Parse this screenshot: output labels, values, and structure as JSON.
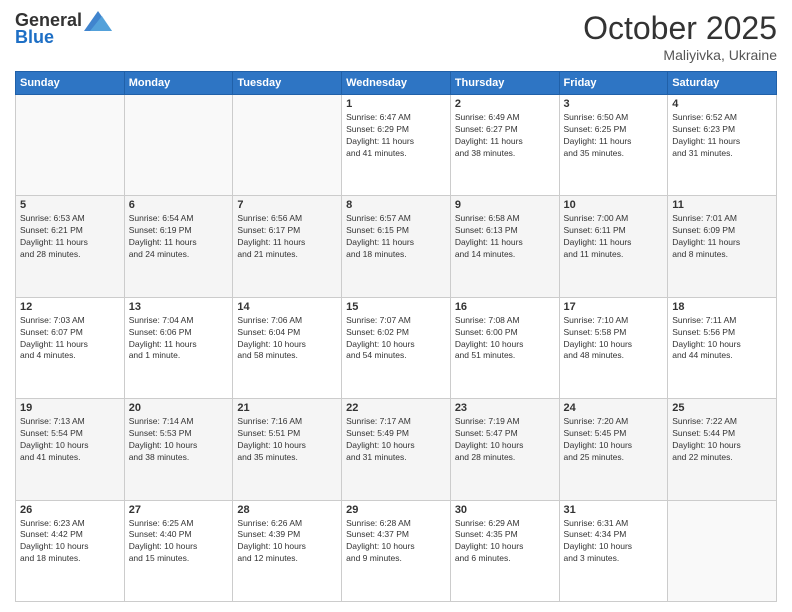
{
  "header": {
    "logo_general": "General",
    "logo_blue": "Blue",
    "month_title": "October 2025",
    "location": "Maliyivka, Ukraine"
  },
  "days_of_week": [
    "Sunday",
    "Monday",
    "Tuesday",
    "Wednesday",
    "Thursday",
    "Friday",
    "Saturday"
  ],
  "weeks": [
    [
      {
        "day": "",
        "info": ""
      },
      {
        "day": "",
        "info": ""
      },
      {
        "day": "",
        "info": ""
      },
      {
        "day": "1",
        "info": "Sunrise: 6:47 AM\nSunset: 6:29 PM\nDaylight: 11 hours\nand 41 minutes."
      },
      {
        "day": "2",
        "info": "Sunrise: 6:49 AM\nSunset: 6:27 PM\nDaylight: 11 hours\nand 38 minutes."
      },
      {
        "day": "3",
        "info": "Sunrise: 6:50 AM\nSunset: 6:25 PM\nDaylight: 11 hours\nand 35 minutes."
      },
      {
        "day": "4",
        "info": "Sunrise: 6:52 AM\nSunset: 6:23 PM\nDaylight: 11 hours\nand 31 minutes."
      }
    ],
    [
      {
        "day": "5",
        "info": "Sunrise: 6:53 AM\nSunset: 6:21 PM\nDaylight: 11 hours\nand 28 minutes."
      },
      {
        "day": "6",
        "info": "Sunrise: 6:54 AM\nSunset: 6:19 PM\nDaylight: 11 hours\nand 24 minutes."
      },
      {
        "day": "7",
        "info": "Sunrise: 6:56 AM\nSunset: 6:17 PM\nDaylight: 11 hours\nand 21 minutes."
      },
      {
        "day": "8",
        "info": "Sunrise: 6:57 AM\nSunset: 6:15 PM\nDaylight: 11 hours\nand 18 minutes."
      },
      {
        "day": "9",
        "info": "Sunrise: 6:58 AM\nSunset: 6:13 PM\nDaylight: 11 hours\nand 14 minutes."
      },
      {
        "day": "10",
        "info": "Sunrise: 7:00 AM\nSunset: 6:11 PM\nDaylight: 11 hours\nand 11 minutes."
      },
      {
        "day": "11",
        "info": "Sunrise: 7:01 AM\nSunset: 6:09 PM\nDaylight: 11 hours\nand 8 minutes."
      }
    ],
    [
      {
        "day": "12",
        "info": "Sunrise: 7:03 AM\nSunset: 6:07 PM\nDaylight: 11 hours\nand 4 minutes."
      },
      {
        "day": "13",
        "info": "Sunrise: 7:04 AM\nSunset: 6:06 PM\nDaylight: 11 hours\nand 1 minute."
      },
      {
        "day": "14",
        "info": "Sunrise: 7:06 AM\nSunset: 6:04 PM\nDaylight: 10 hours\nand 58 minutes."
      },
      {
        "day": "15",
        "info": "Sunrise: 7:07 AM\nSunset: 6:02 PM\nDaylight: 10 hours\nand 54 minutes."
      },
      {
        "day": "16",
        "info": "Sunrise: 7:08 AM\nSunset: 6:00 PM\nDaylight: 10 hours\nand 51 minutes."
      },
      {
        "day": "17",
        "info": "Sunrise: 7:10 AM\nSunset: 5:58 PM\nDaylight: 10 hours\nand 48 minutes."
      },
      {
        "day": "18",
        "info": "Sunrise: 7:11 AM\nSunset: 5:56 PM\nDaylight: 10 hours\nand 44 minutes."
      }
    ],
    [
      {
        "day": "19",
        "info": "Sunrise: 7:13 AM\nSunset: 5:54 PM\nDaylight: 10 hours\nand 41 minutes."
      },
      {
        "day": "20",
        "info": "Sunrise: 7:14 AM\nSunset: 5:53 PM\nDaylight: 10 hours\nand 38 minutes."
      },
      {
        "day": "21",
        "info": "Sunrise: 7:16 AM\nSunset: 5:51 PM\nDaylight: 10 hours\nand 35 minutes."
      },
      {
        "day": "22",
        "info": "Sunrise: 7:17 AM\nSunset: 5:49 PM\nDaylight: 10 hours\nand 31 minutes."
      },
      {
        "day": "23",
        "info": "Sunrise: 7:19 AM\nSunset: 5:47 PM\nDaylight: 10 hours\nand 28 minutes."
      },
      {
        "day": "24",
        "info": "Sunrise: 7:20 AM\nSunset: 5:45 PM\nDaylight: 10 hours\nand 25 minutes."
      },
      {
        "day": "25",
        "info": "Sunrise: 7:22 AM\nSunset: 5:44 PM\nDaylight: 10 hours\nand 22 minutes."
      }
    ],
    [
      {
        "day": "26",
        "info": "Sunrise: 6:23 AM\nSunset: 4:42 PM\nDaylight: 10 hours\nand 18 minutes."
      },
      {
        "day": "27",
        "info": "Sunrise: 6:25 AM\nSunset: 4:40 PM\nDaylight: 10 hours\nand 15 minutes."
      },
      {
        "day": "28",
        "info": "Sunrise: 6:26 AM\nSunset: 4:39 PM\nDaylight: 10 hours\nand 12 minutes."
      },
      {
        "day": "29",
        "info": "Sunrise: 6:28 AM\nSunset: 4:37 PM\nDaylight: 10 hours\nand 9 minutes."
      },
      {
        "day": "30",
        "info": "Sunrise: 6:29 AM\nSunset: 4:35 PM\nDaylight: 10 hours\nand 6 minutes."
      },
      {
        "day": "31",
        "info": "Sunrise: 6:31 AM\nSunset: 4:34 PM\nDaylight: 10 hours\nand 3 minutes."
      },
      {
        "day": "",
        "info": ""
      }
    ]
  ]
}
